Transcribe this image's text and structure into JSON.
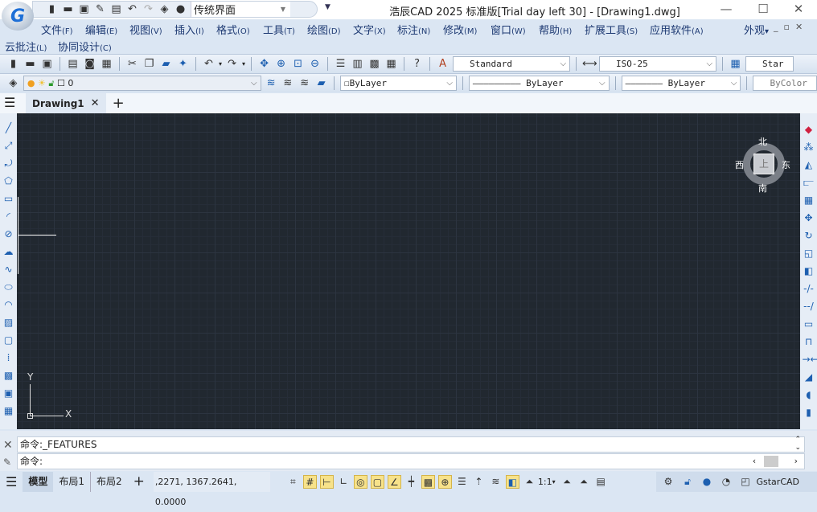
{
  "app": {
    "title": "浩辰CAD 2025 标准版[Trial day left 30] - [Drawing1.dwg]",
    "logo_letter": "G"
  },
  "quick_access": {
    "workspace": "传统界面",
    "icons": [
      "new-icon",
      "open-icon",
      "save-icon",
      "save-as-icon",
      "print-icon",
      "undo-icon",
      "redo-icon",
      "layers-icon",
      "comment-icon"
    ]
  },
  "window_controls": {
    "minimize": "—",
    "maximize": "☐",
    "close": "✕"
  },
  "menu": [
    {
      "label": "文件",
      "key": "(F)"
    },
    {
      "label": "编辑",
      "key": "(E)"
    },
    {
      "label": "视图",
      "key": "(V)"
    },
    {
      "label": "插入",
      "key": "(I)"
    },
    {
      "label": "格式",
      "key": "(O)"
    },
    {
      "label": "工具",
      "key": "(T)"
    },
    {
      "label": "绘图",
      "key": "(D)"
    },
    {
      "label": "文字",
      "key": "(X)"
    },
    {
      "label": "标注",
      "key": "(N)"
    },
    {
      "label": "修改",
      "key": "(M)"
    },
    {
      "label": "窗口",
      "key": "(W)"
    },
    {
      "label": "帮助",
      "key": "(H)"
    },
    {
      "label": "扩展工具",
      "key": "(S)"
    },
    {
      "label": "应用软件",
      "key": "(A)"
    }
  ],
  "menu2": [
    {
      "label": "云批注",
      "key": "(L)"
    },
    {
      "label": "协同设计",
      "key": "(C)"
    }
  ],
  "appearance": "外观",
  "toolbar": {
    "text_style": "Standard",
    "dim_style": "ISO-25",
    "table_style": "Star"
  },
  "layer_bar": {
    "layer": "0",
    "color": "ByLayer",
    "linetype": "ByLayer",
    "lineweight": "ByLayer",
    "plotstyle": "ByColor"
  },
  "tabs": {
    "doc": "Drawing1",
    "add": "+"
  },
  "viewcube": {
    "north": "北",
    "south": "南",
    "east": "东",
    "west": "西",
    "top": "上"
  },
  "ucs": {
    "x": "X",
    "y": "Y"
  },
  "command": {
    "history": "命令:_FEATURES",
    "prompt": "命令:"
  },
  "status": {
    "model": "模型",
    "layout1": "布局1",
    "layout2": "布局2",
    "add": "+",
    "coords": ",2271, 1367.2641, 0.0000",
    "scale": "1:1",
    "brand": "GstarCAD"
  }
}
